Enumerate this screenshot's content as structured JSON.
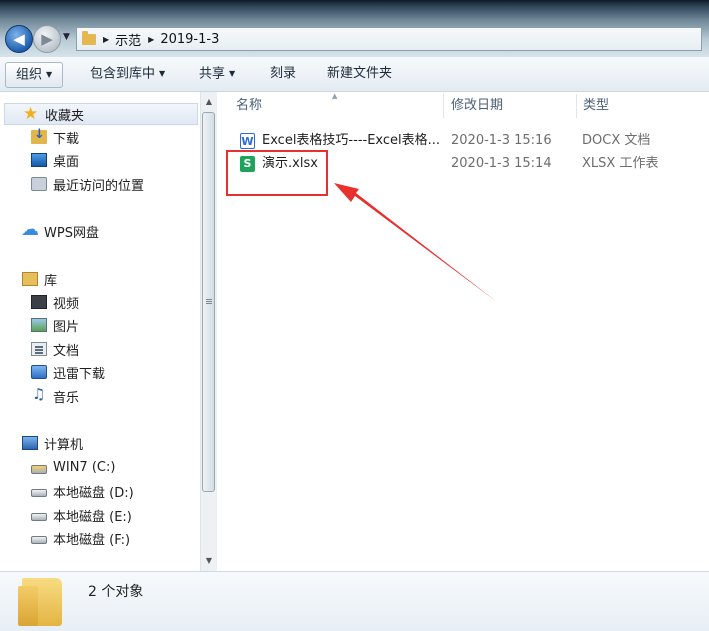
{
  "address": {
    "breadcrumbs": [
      "示范",
      "2019-1-3"
    ]
  },
  "toolbar": {
    "organize": "组织",
    "include_in_library": "包含到库中",
    "share": "共享",
    "burn": "刻录",
    "new_folder": "新建文件夹"
  },
  "nav": {
    "favorites": "收藏夹",
    "downloads": "下载",
    "desktop": "桌面",
    "recent": "最近访问的位置",
    "wps": "WPS网盘",
    "libraries": "库",
    "videos": "视频",
    "pictures": "图片",
    "documents": "文档",
    "thunder": "迅雷下载",
    "music": "音乐",
    "computer": "计算机",
    "drive_c": "WIN7 (C:)",
    "drive_d": "本地磁盘 (D:)",
    "drive_e": "本地磁盘 (E:)",
    "drive_f": "本地磁盘 (F:)"
  },
  "columns": {
    "name": "名称",
    "modified": "修改日期",
    "type": "类型"
  },
  "files": [
    {
      "icon": "W",
      "name": "Excel表格技巧----Excel表格...",
      "modified": "2020-1-3 15:16",
      "type": "DOCX 文档"
    },
    {
      "icon": "S",
      "name": "演示.xlsx",
      "modified": "2020-1-3 15:14",
      "type": "XLSX 工作表"
    }
  ],
  "status": {
    "count": "2 个对象"
  },
  "colors": {
    "annotation": "#e8302f"
  }
}
